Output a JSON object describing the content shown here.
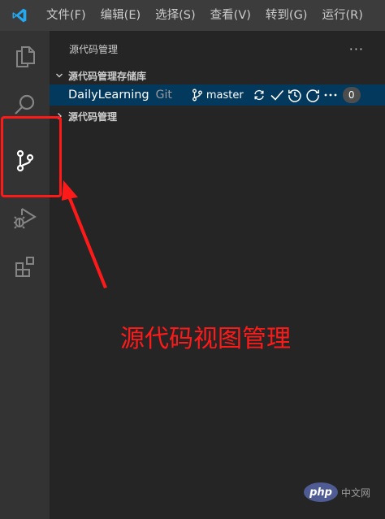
{
  "menubar": {
    "items": [
      "文件(F)",
      "编辑(E)",
      "选择(S)",
      "查看(V)",
      "转到(G)",
      "运行(R)"
    ]
  },
  "activitybar": {
    "icons": [
      "explorer-icon",
      "search-icon",
      "source-control-icon",
      "run-debug-icon",
      "extensions-icon"
    ]
  },
  "sidebar": {
    "title": "源代码管理",
    "more": "···",
    "repos_section": "源代码管理存储库",
    "repo": {
      "name": "DailyLearning",
      "type": "Git",
      "branch": "master",
      "badge": "0"
    },
    "changes_section": "源代码管理"
  },
  "annotation": {
    "text": "源代码视图管理",
    "color": "#ff1a1a"
  },
  "watermark": {
    "logo": "php",
    "text": "中文网"
  },
  "colors": {
    "menubar": "#3c3c3c",
    "activitybar": "#333333",
    "sidebar": "#252526",
    "selected_row": "#04395e",
    "vscode_blue": "#23a9f2"
  }
}
